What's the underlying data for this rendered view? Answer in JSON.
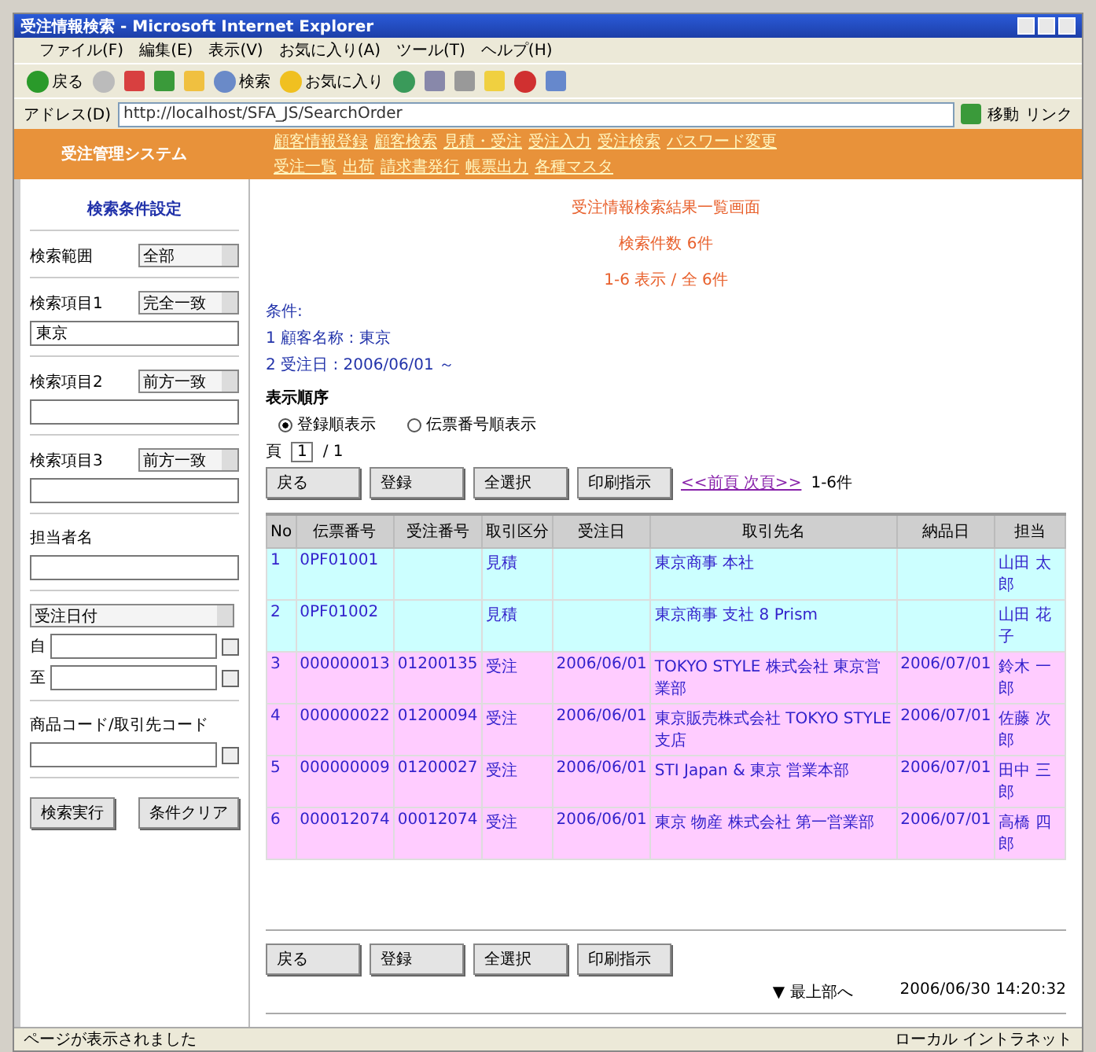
{
  "window": {
    "title": "受注情報検索 - Microsoft Internet Explorer"
  },
  "menu": [
    "ファイル(F)",
    "編集(E)",
    "表示(V)",
    "お気に入り(A)",
    "ツール(T)",
    "ヘルプ(H)"
  ],
  "toolbar": {
    "back": "戻る",
    "search": "検索",
    "favorites": "お気に入り"
  },
  "address": {
    "label": "アドレス(D)",
    "url": "http://localhost/SFA_JS/SearchOrder",
    "go": "移動",
    "links": "リンク"
  },
  "header": {
    "logo": "受注管理システム",
    "nav": [
      [
        "顧客情報登録",
        "顧客検索",
        "見積・受注",
        "受注入力",
        "受注検索",
        "パスワード変更"
      ],
      [
        "受注一覧",
        "出荷",
        "請求書発行",
        "帳票出力",
        "各種マスタ"
      ]
    ]
  },
  "sidebar": {
    "title": "検索条件設定",
    "groups": [
      {
        "kind": "select",
        "label": "検索範囲",
        "option": "全部"
      },
      {
        "kind": "select-input",
        "label": "検索項目1",
        "option": "完全一致",
        "value": "東京"
      },
      {
        "kind": "select-input",
        "label": "検索項目2",
        "option": "前方一致"
      },
      {
        "kind": "select-input",
        "label": "検索項目3",
        "option": "前方一致"
      },
      {
        "kind": "input",
        "label": "担当者名"
      },
      {
        "kind": "dates",
        "option": "受注日付",
        "from": "自",
        "to": "至"
      },
      {
        "kind": "input-icon",
        "label": "商品コード/取引先コード"
      }
    ],
    "buttons": [
      "検索実行",
      "条件クリア"
    ]
  },
  "main": {
    "headings": [
      "受注情報検索結果一覧画面",
      "検索件数 6件",
      "1-6 表示 / 全 6件"
    ],
    "conditions": [
      "条件:",
      "1 顧客名称 : 東京",
      "2 受注日 : 2006/06/01 ～"
    ],
    "sort": {
      "label": "表示順序",
      "options": [
        {
          "label": "登録順表示",
          "selected": true
        },
        {
          "label": "伝票番号順表示",
          "selected": false
        }
      ]
    },
    "page": {
      "label": "頁",
      "value": "1",
      "total": "/ 1"
    },
    "buttons": [
      "戻る",
      "登録",
      "全選択",
      "印刷指示"
    ],
    "footer_buttons": [
      "戻る",
      "登録",
      "全選択",
      "印刷指示"
    ],
    "pager": {
      "link": "<<前頁  次頁>>",
      "count": "1-6件"
    },
    "columns": [
      "No",
      "伝票番号",
      "受注番号",
      "取引区分",
      "受注日",
      "取引先名",
      "納品日",
      "担当"
    ],
    "rows": [
      {
        "color": "#ccffff",
        "cells": [
          "1",
          "0PF01001",
          "",
          "見積",
          "",
          "東京商事 本社",
          "",
          "山田 太郎"
        ]
      },
      {
        "color": "#ccffff",
        "cells": [
          "2",
          "0PF01002",
          "",
          "見積",
          "",
          "東京商事 支社 8 Prism",
          "",
          "山田 花子"
        ]
      },
      {
        "color": "#ffccff",
        "cells": [
          "3",
          "000000013",
          "01200135",
          "受注",
          "2006/06/01",
          "TOKYO STYLE 株式会社 東京営業部",
          "2006/07/01",
          "鈴木 一郎"
        ]
      },
      {
        "color": "#ffccff",
        "cells": [
          "4",
          "000000022",
          "01200094",
          "受注",
          "2006/06/01",
          "東京販売株式会社 TOKYO STYLE支店",
          "2006/07/01",
          "佐藤 次郎"
        ]
      },
      {
        "color": "#ffccff",
        "cells": [
          "5",
          "000000009",
          "01200027",
          "受注",
          "2006/06/01",
          "STI Japan & 東京 営業本部",
          "2006/07/01",
          "田中 三郎"
        ]
      },
      {
        "color": "#ffccff",
        "cells": [
          "6",
          "000012074",
          "00012074",
          "受注",
          "2006/06/01",
          "東京 物産 株式会社 第一営業部",
          "2006/07/01",
          "高橋 四郎"
        ]
      }
    ],
    "footer": {
      "top": "▼ 最上部へ",
      "date": "2006/06/30 14:20:32"
    }
  },
  "status": {
    "text": "ページが表示されました",
    "zone": "ローカル イントラネット"
  }
}
